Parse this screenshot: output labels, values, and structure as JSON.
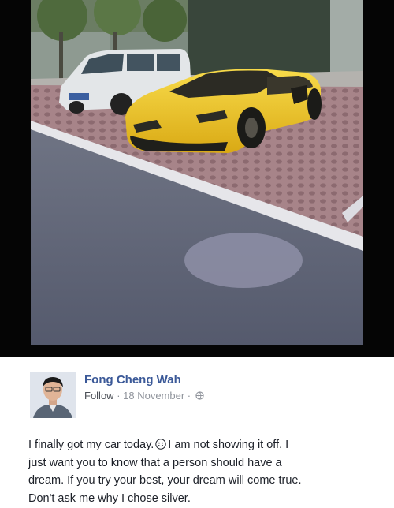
{
  "post": {
    "author": "Fong Cheng Wah",
    "follow_label": "Follow",
    "separator": " · ",
    "date": "18 November",
    "lines": [
      "I finally got my car today.",
      "I am not showing it off. I",
      "just want you to know that a person should have a",
      "dream. If you try your best, your dream will come true.",
      "Don't ask me why I chose silver."
    ]
  },
  "icons": {
    "privacy": "globe-icon",
    "emoji": "smiley-icon"
  },
  "colors": {
    "author_link": "#3b5998",
    "meta_text": "#90949c",
    "photo_border": "#050505",
    "car_yellow": "#f3cd2c"
  }
}
